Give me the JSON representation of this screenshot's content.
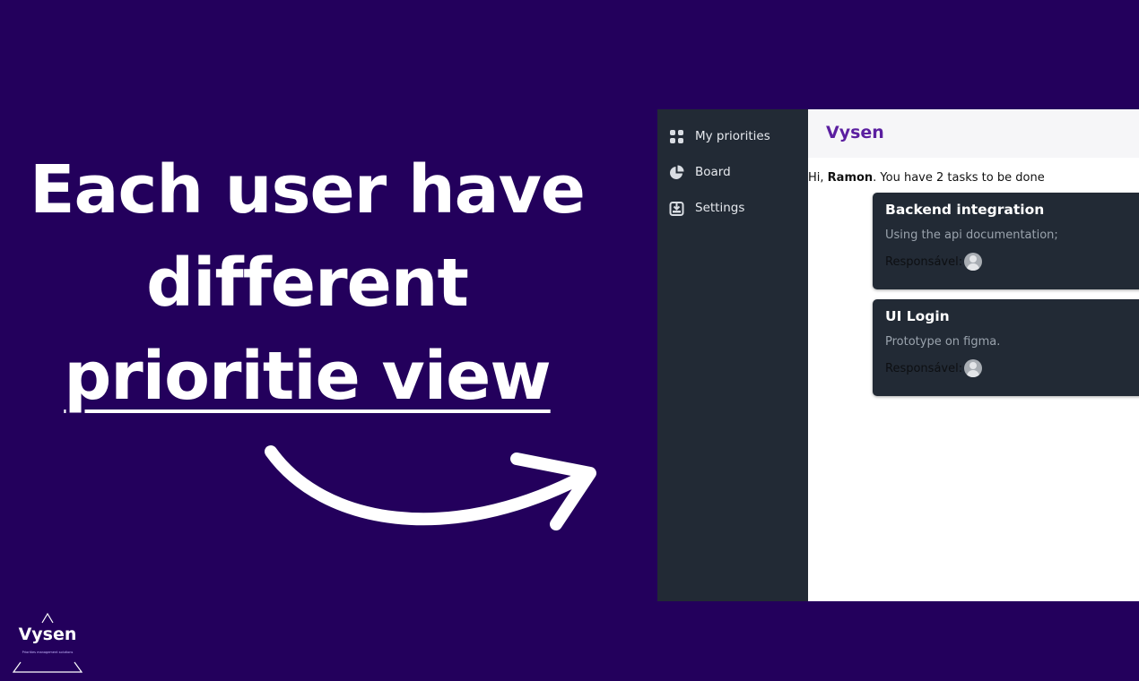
{
  "headline": {
    "line1": "Each user have",
    "line2": "different",
    "line3": "prioritie view"
  },
  "app": {
    "brand": "Vysen",
    "sidebar": {
      "items": [
        {
          "label": "My priorities",
          "icon": "grid-icon"
        },
        {
          "label": "Board",
          "icon": "pie-chart-icon"
        },
        {
          "label": "Settings",
          "icon": "settings-box-icon"
        }
      ]
    },
    "greeting": {
      "prefix": "Hi, ",
      "name": "Ramon",
      "suffix": ". You have 2 tasks to be done"
    },
    "tasks": [
      {
        "title": "Backend integration",
        "description": "Using the api documentation;",
        "responsible_label": "Responsável:"
      },
      {
        "title": "UI Login",
        "description": "Prototype on figma.",
        "responsible_label": "Responsável:"
      }
    ]
  },
  "logo": {
    "name": "Vysen",
    "tagline": "Priorities management solutions"
  },
  "colors": {
    "background": "#23005c",
    "sidebar": "#222a35",
    "brand": "#5b1fa0",
    "card": "#222a35"
  }
}
